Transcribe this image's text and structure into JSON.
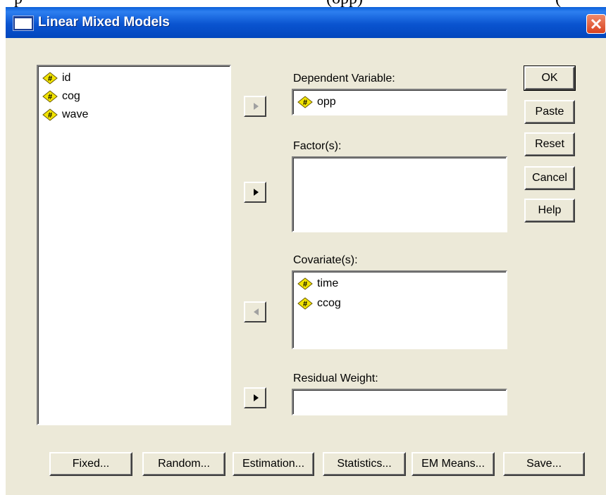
{
  "background_text": {
    "left": "p",
    "middle": "(opp)",
    "right": "("
  },
  "window": {
    "title": "Linear Mixed Models"
  },
  "source_list": {
    "items": [
      {
        "label": "id",
        "icon": "numeric-variable-icon"
      },
      {
        "label": "cog",
        "icon": "numeric-variable-icon"
      },
      {
        "label": "wave",
        "icon": "numeric-variable-icon"
      }
    ]
  },
  "dependent": {
    "label": "Dependent Variable:",
    "value": "opp"
  },
  "factors": {
    "label": "Factor(s):"
  },
  "covariates": {
    "label": "Covariate(s):",
    "items": [
      "time",
      "ccog"
    ]
  },
  "residual_weight": {
    "label": "Residual Weight:"
  },
  "side_buttons": {
    "ok": "OK",
    "paste": "Paste",
    "reset": "Reset",
    "cancel": "Cancel",
    "help": "Help"
  },
  "bottom_buttons": {
    "fixed": "Fixed...",
    "random": "Random...",
    "estimation": "Estimation...",
    "statistics": "Statistics...",
    "em_means": "EM Means...",
    "save": "Save..."
  },
  "colors": {
    "dialog_bg": "#ece9d8",
    "titlebar": "#0a54d0",
    "close": "#d9421f",
    "var_icon": "#f2e400"
  }
}
